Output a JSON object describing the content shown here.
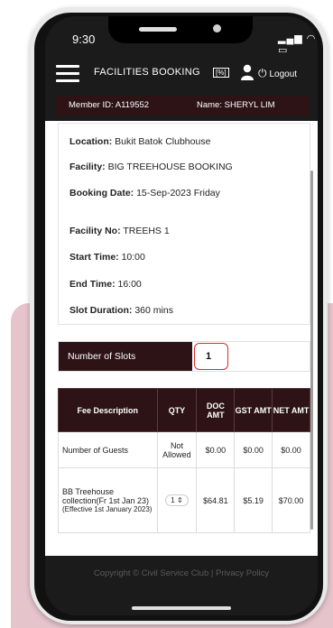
{
  "status": {
    "time": "9:30"
  },
  "header": {
    "title": "FACILITIES BOOKING",
    "pct_icon": "[%]",
    "logout_label": "Logout"
  },
  "member": {
    "id": "Member ID: A119552",
    "name": "Name: SHERYL LIM"
  },
  "booking": {
    "location_label": "Location:",
    "location_value": "Bukit Batok Clubhouse",
    "facility_label": "Facility:",
    "facility_value": "BIG TREEHOUSE BOOKING",
    "date_label": "Booking Date:",
    "date_value": "15-Sep-2023 Friday",
    "facility_no_label": "Facility No:",
    "facility_no_value": "TREEHS 1",
    "start_label": "Start Time:",
    "start_value": "10:00",
    "end_label": "End Time:",
    "end_value": "16:00",
    "duration_label": "Slot Duration:",
    "duration_value": "360 mins"
  },
  "slots": {
    "label": "Number of Slots",
    "value": "1"
  },
  "fee_table": {
    "headers": [
      "Fee Description",
      "QTY",
      "DOC AMT",
      "GST AMT",
      "NET AMT"
    ],
    "rows": [
      {
        "desc": "Number of Guests",
        "qty": "Not Allowed",
        "doc": "$0.00",
        "gst": "$0.00",
        "net": "$0.00"
      },
      {
        "desc": "BB Treehouse collection(Fr 1st Jan 23)",
        "desc_sub": "(Effective 1st January 2023)",
        "qty": "1",
        "doc": "$64.81",
        "gst": "$5.19",
        "net": "$70.00"
      }
    ]
  },
  "footer": {
    "text": "Copyright © Civil Service Club | Privacy Policy"
  },
  "icons": {
    "menu": "hamburger-icon",
    "user": "user-icon",
    "power": "power-icon",
    "stepper": "stepper-icon"
  },
  "colors": {
    "brand_dark": "#2d1316",
    "header_bg": "#1b1b1b",
    "highlight": "#d72c2c",
    "pink": "#e5c4cc"
  }
}
